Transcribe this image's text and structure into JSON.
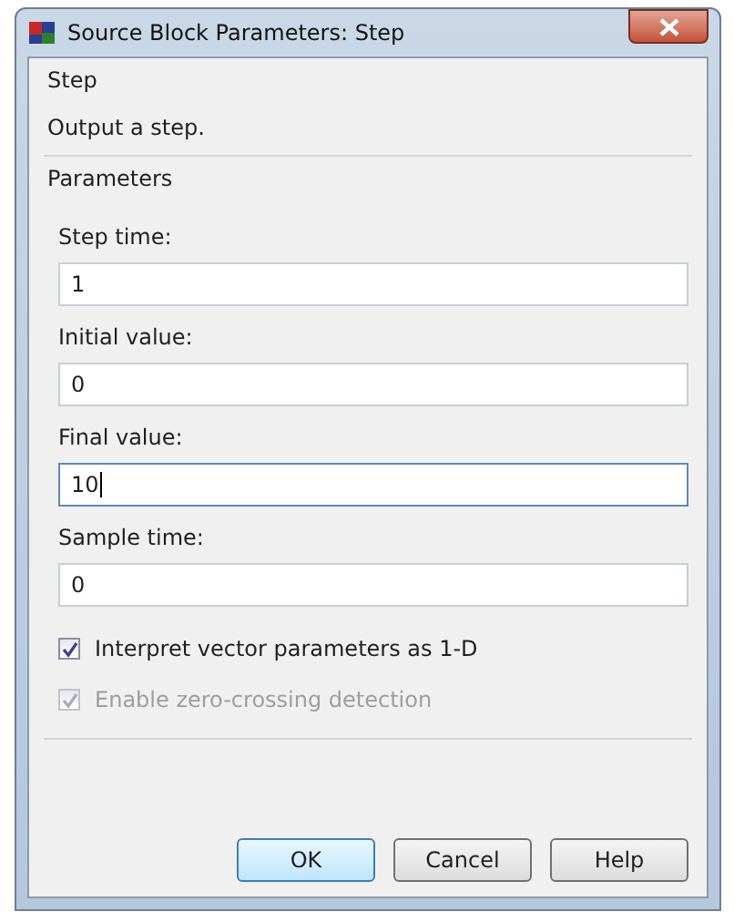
{
  "window": {
    "title": "Source Block Parameters: Step"
  },
  "description_group": {
    "title": "Step",
    "text": "Output a step."
  },
  "parameters_group": {
    "title": "Parameters",
    "fields": [
      {
        "label": "Step time:",
        "value": "1",
        "focused": false
      },
      {
        "label": "Initial value:",
        "value": "0",
        "focused": false
      },
      {
        "label": "Final value:",
        "value": "10",
        "focused": true
      },
      {
        "label": "Sample time:",
        "value": "0",
        "focused": false
      }
    ],
    "checkboxes": [
      {
        "label": "Interpret vector parameters as 1-D",
        "checked": true,
        "disabled": false
      },
      {
        "label": "Enable zero-crossing detection",
        "checked": true,
        "disabled": true
      }
    ]
  },
  "buttons": [
    {
      "label": "OK",
      "default": true
    },
    {
      "label": "Cancel",
      "default": false
    },
    {
      "label": "Help",
      "default": false
    }
  ]
}
